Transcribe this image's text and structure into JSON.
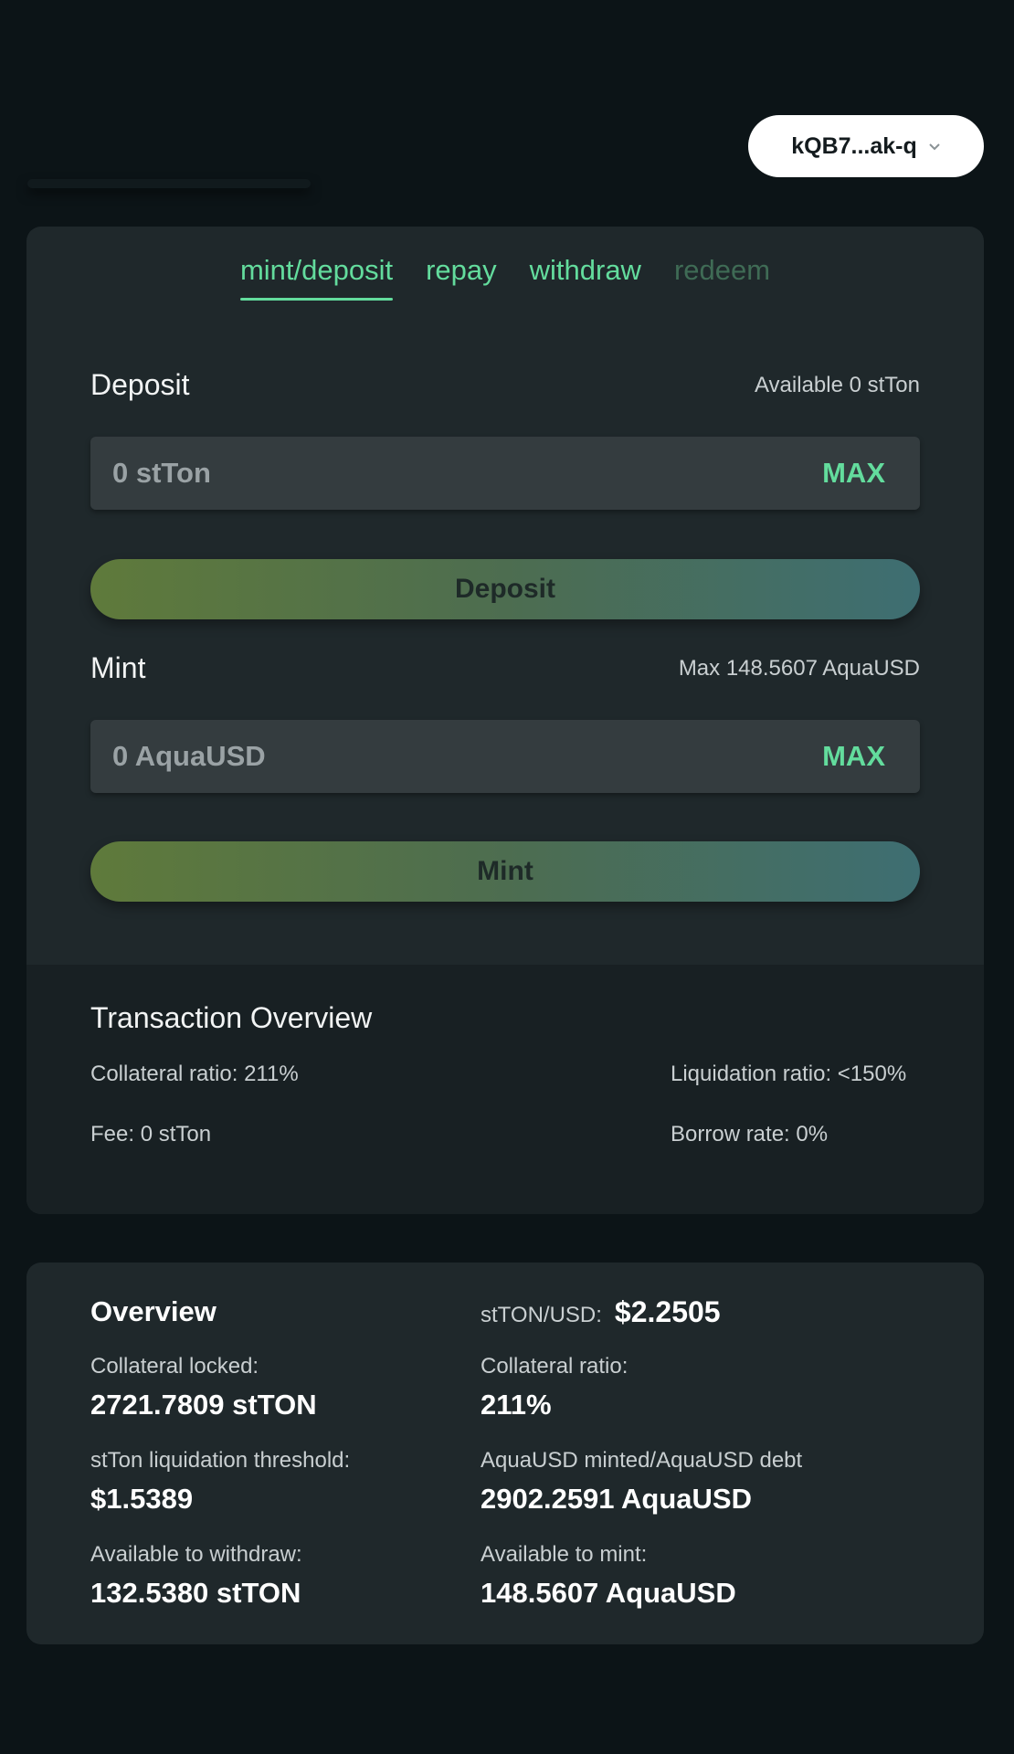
{
  "wallet": {
    "address": "kQB7...ak-q"
  },
  "tabs": [
    {
      "label": "mint/deposit",
      "active": true
    },
    {
      "label": "repay"
    },
    {
      "label": "withdraw"
    },
    {
      "label": "redeem",
      "disabled": true
    }
  ],
  "deposit": {
    "label": "Deposit",
    "available": "Available 0 stTon",
    "placeholder": "0 stTon",
    "max_label": "MAX",
    "button_label": "Deposit"
  },
  "mint": {
    "label": "Mint",
    "max_hint": "Max 148.5607 AquaUSD",
    "placeholder": "0 AquaUSD",
    "max_label": "MAX",
    "button_label": "Mint"
  },
  "transaction_overview": {
    "title": "Transaction Overview",
    "collateral_ratio": "Collateral ratio: 211%",
    "liquidation_ratio": "Liquidation ratio: <150%",
    "fee": "Fee: 0 stTon",
    "borrow_rate": "Borrow rate: 0%"
  },
  "overview": {
    "title": "Overview",
    "price_label": "stTON/USD:",
    "price_value": "$2.2505",
    "stats": [
      {
        "label": "Collateral locked:",
        "value": "2721.7809 stTON"
      },
      {
        "label": "Collateral ratio:",
        "value": "211%"
      },
      {
        "label": "stTon liquidation threshold:",
        "value": "$1.5389"
      },
      {
        "label": "AquaUSD minted/AquaUSD debt",
        "value": "2902.2591 AquaUSD"
      },
      {
        "label": "Available to withdraw:",
        "value": "132.5380 stTON"
      },
      {
        "label": "Available to mint:",
        "value": "148.5607 AquaUSD"
      }
    ]
  },
  "colors": {
    "accent": "#63dc9d",
    "background": "#0c1417",
    "card": "#1f282b"
  }
}
